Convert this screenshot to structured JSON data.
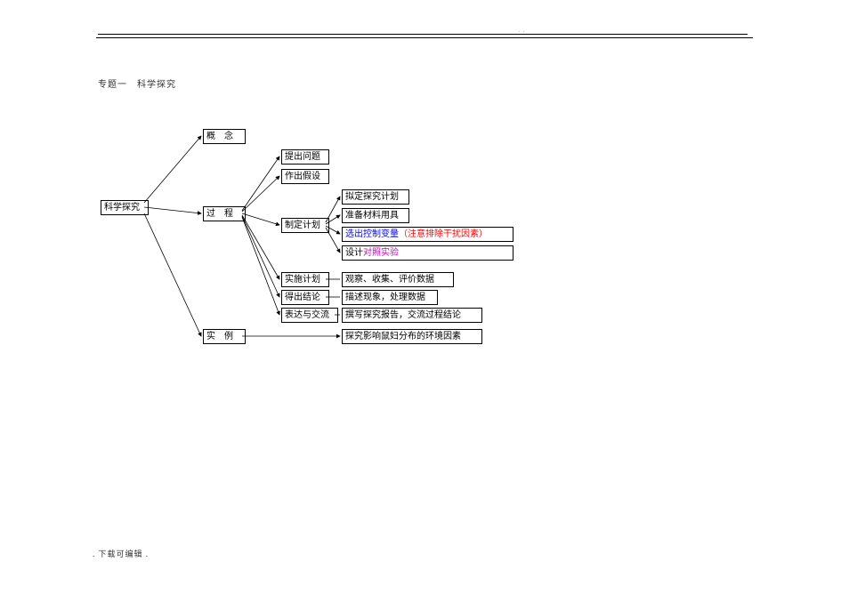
{
  "header": {
    "dots": ". ."
  },
  "title": "专题一　科学探究",
  "footer": ". 下载可编辑 .",
  "root": {
    "label": "科学探究"
  },
  "b_concept": {
    "label": "概　念"
  },
  "b_process": {
    "label": "过　程"
  },
  "b_example": {
    "label": "实　例"
  },
  "p_question": {
    "label": "提出问题"
  },
  "p_hypothesis": {
    "label": "作出假设"
  },
  "p_plan": {
    "label": "制定计划"
  },
  "p_implement": {
    "label": "实施计划"
  },
  "p_conclude": {
    "label": "得出结论"
  },
  "p_communicate": {
    "label": "表达与交流"
  },
  "plan_draft": {
    "label": "拟定探究计划"
  },
  "plan_materials": {
    "label": "准备材料用具"
  },
  "plan_variable": {
    "part1": "选出控制变量",
    "part2": "（注意排除干扰因素）"
  },
  "plan_design": {
    "part1": "设计",
    "part2": "对照实验"
  },
  "d_implement": {
    "label": "观察、收集、评价数据"
  },
  "d_conclude": {
    "label": "描述现象，处理数据"
  },
  "d_communicate": {
    "label": "撰写探究报告，交流过程结论"
  },
  "example_task": {
    "label": "探究影响鼠妇分布的环境因素"
  }
}
